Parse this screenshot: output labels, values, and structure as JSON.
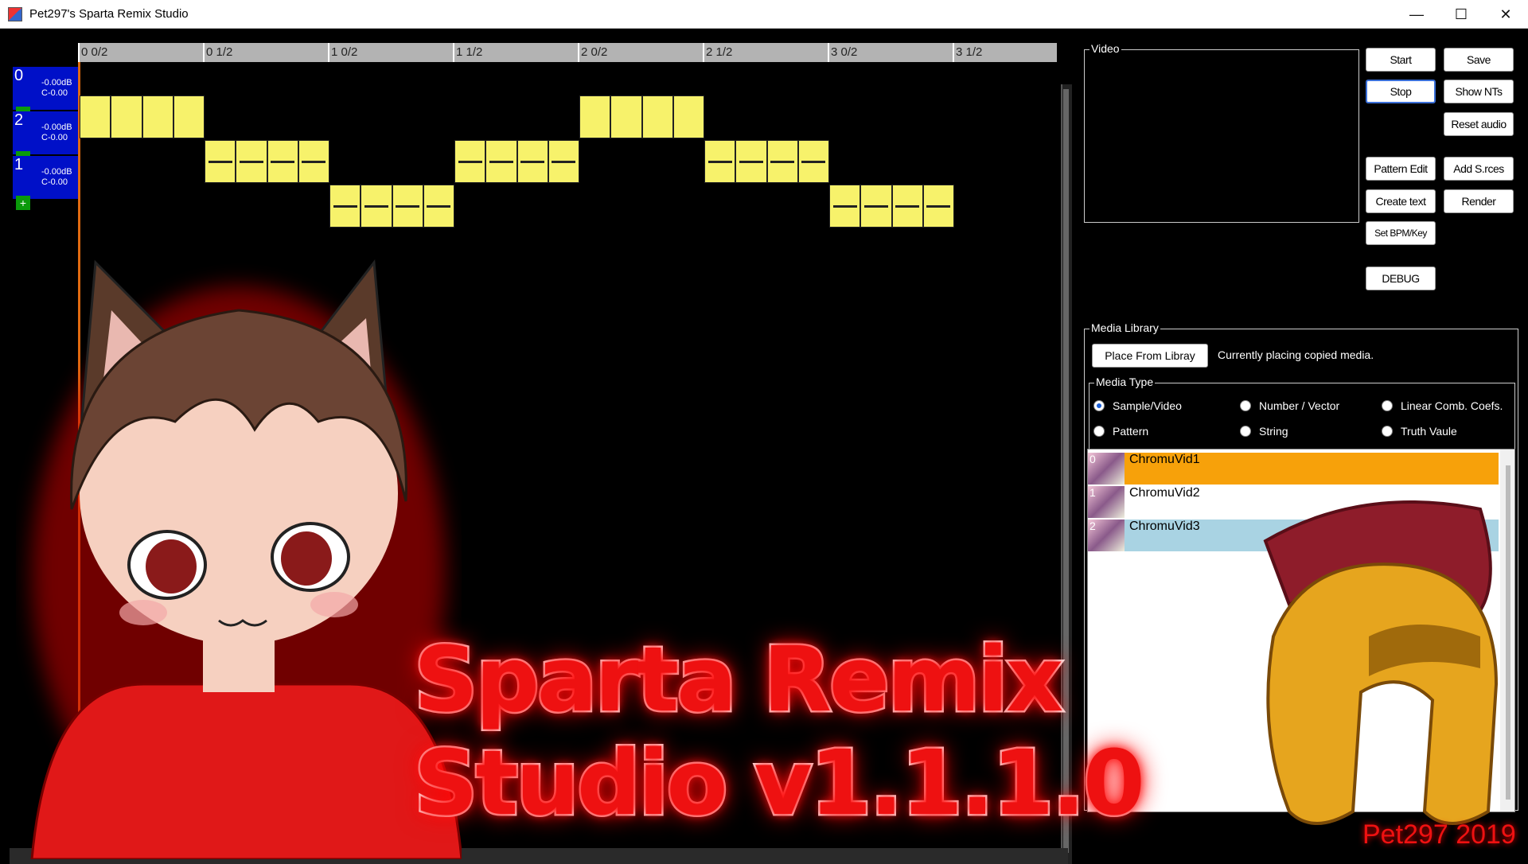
{
  "window": {
    "title": "Pet297's Sparta Remix Studio",
    "minimize": "—",
    "maximize": "☐",
    "close": "✕"
  },
  "timeline": {
    "ticks": [
      "0 0/2",
      "0 1/2",
      "1 0/2",
      "1 1/2",
      "2 0/2",
      "2 1/2",
      "3 0/2",
      "3 1/2"
    ],
    "tracks": [
      {
        "num": "0",
        "db": "-0.00dB",
        "c": "C-0.00",
        "plus": "+"
      },
      {
        "num": "2",
        "db": "-0.00dB",
        "c": "C-0.00",
        "plus": "+"
      },
      {
        "num": "1",
        "db": "-0.00dB",
        "c": "C-0.00",
        "plus": "+"
      }
    ]
  },
  "video": {
    "label": "Video"
  },
  "buttons": {
    "start": "Start",
    "save": "Save",
    "stop": "Stop",
    "show_nts": "Show NTs",
    "reset_audio": "Reset audio",
    "pattern_edit": "Pattern Edit",
    "add_sources": "Add S.rces",
    "create_text": "Create text",
    "render": "Render",
    "set_bpm": "Set BPM/Key",
    "debug": "DEBUG"
  },
  "media_library": {
    "label": "Media Library",
    "place_button": "Place From Libray",
    "status": "Currently placing copied media.",
    "media_type_label": "Media Type",
    "types": [
      "Sample/Video",
      "Number / Vector",
      "Linear Comb. Coefs.",
      "Pattern",
      "String",
      "Truth Vaule"
    ],
    "selected_type": "Sample/Video",
    "items": [
      {
        "index": "0",
        "name": "ChromuVid1"
      },
      {
        "index": "1",
        "name": "ChromuVid2"
      },
      {
        "index": "2",
        "name": "ChromuVid3"
      }
    ]
  },
  "overlay": {
    "title_line1": "Sparta Remix",
    "title_line2": "Studio v1.1.1.0",
    "credit": "Pet297 2019"
  },
  "colors": {
    "note": "#f7f26b",
    "track_head": "#0010c8",
    "selected_item": "#f7a10a",
    "title_red": "#e11111"
  },
  "icons": {
    "app": "app-icon",
    "helmet": "spartan-helmet-icon"
  }
}
